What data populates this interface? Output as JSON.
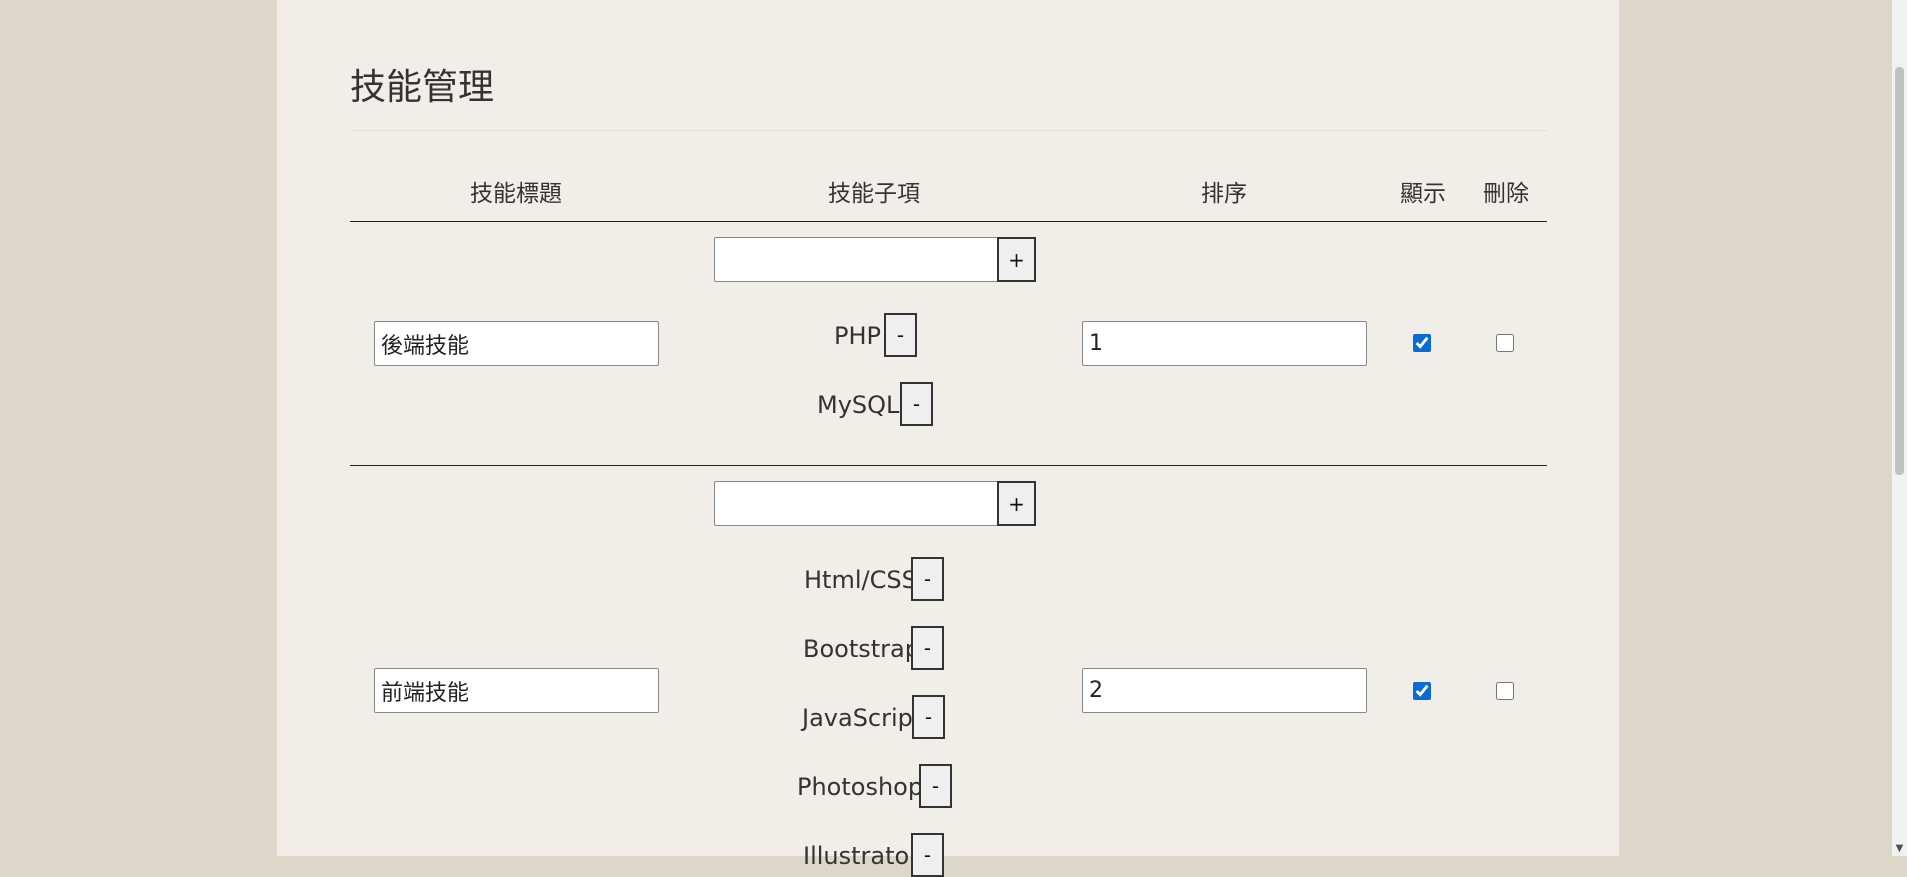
{
  "page": {
    "title": "技能管理"
  },
  "table": {
    "headers": {
      "title": "技能標題",
      "items": "技能子項",
      "order": "排序",
      "show": "顯示",
      "delete": "刪除"
    },
    "rows": [
      {
        "title": "後端技能",
        "add_value": "",
        "add_label": "+",
        "order": "1",
        "show": true,
        "delete": false,
        "items": [
          {
            "label": "PHP",
            "remove_label": "-"
          },
          {
            "label": "MySQL",
            "remove_label": "-"
          }
        ]
      },
      {
        "title": "前端技能",
        "add_value": "",
        "add_label": "+",
        "order": "2",
        "show": true,
        "delete": false,
        "items": [
          {
            "label": "Html/CSS",
            "remove_label": "-"
          },
          {
            "label": "Bootstrap",
            "remove_label": "-"
          },
          {
            "label": "JavaScript",
            "remove_label": "-"
          },
          {
            "label": "Photoshop",
            "remove_label": "-"
          },
          {
            "label": "Illustrator",
            "remove_label": "-"
          }
        ]
      }
    ]
  },
  "scrollbar": {
    "down_arrow_icon": "chevron-down-icon"
  }
}
